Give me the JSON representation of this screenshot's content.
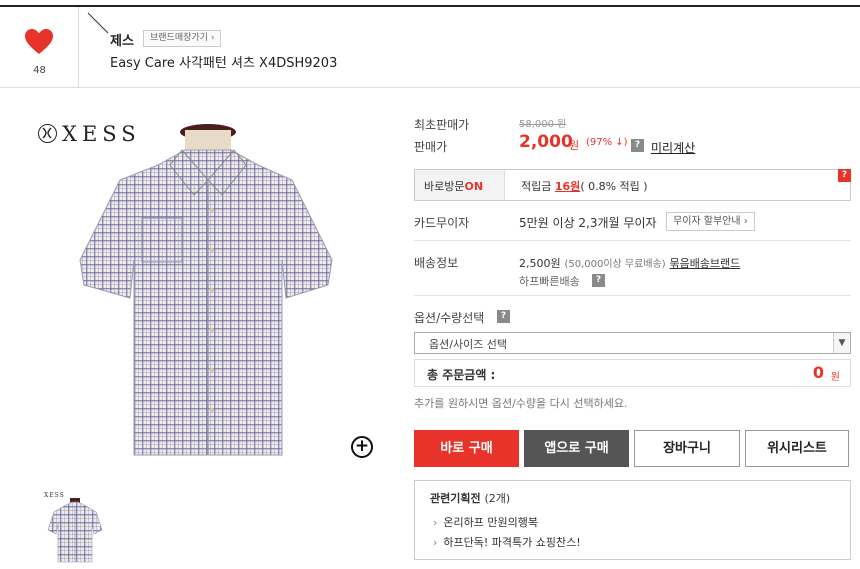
{
  "like": {
    "count": "48",
    "icon": "heart-icon",
    "color": "#e8332a"
  },
  "brand": {
    "name": "제스",
    "store_button": "브랜드매장가기 ›"
  },
  "product": {
    "title": "Easy Care 사각패턴 셔츠 X4DSH9203"
  },
  "logo": {
    "text": "XESS",
    "thumb_text": "XESS"
  },
  "price": {
    "initial_label": "최초판매가",
    "original": "58,000 원",
    "sale_label": "판매가",
    "sale": "2,000",
    "sale_unit": "원",
    "discount": "(97% ↓)",
    "calc_link": "미리계산"
  },
  "visit": {
    "label": "바로방문",
    "on": "ON",
    "point_prefix": "적립금",
    "point_value": "16원",
    "point_suffix": "( 0.8% 적립 )"
  },
  "card": {
    "label": "카드무이자",
    "text": "5만원 이상 2,3개월 무이자",
    "button": "무이자 할부안내 ›"
  },
  "shipping": {
    "label": "배송정보",
    "fee": "2,500원",
    "free_note": "(50,000이상 무료배송)",
    "bundle_link": "묶음배송브랜드",
    "fast": "하프빠른배송"
  },
  "options": {
    "label": "옵션/수량선택",
    "select_value": "옵션/사이즈 선택"
  },
  "total": {
    "label": "총 주문금액 :",
    "amount": "0",
    "unit": "원"
  },
  "help_text": "추가를 원하시면 옵션/수량을 다시 선택하세요.",
  "buttons": {
    "buy": "바로 구매",
    "app": "앱으로 구매",
    "cart": "장바구니",
    "wish": "위시리스트"
  },
  "promo": {
    "title": "관련기획전",
    "count": "(2개)",
    "items": [
      "온리하프 만원의행복",
      "하프단독! 파격특가 쇼핑찬스!"
    ]
  },
  "help_icon": "?",
  "zoom_icon": "+",
  "colors": {
    "accent": "#e8332a",
    "dark_button": "#555555",
    "border": "#cccccc"
  }
}
